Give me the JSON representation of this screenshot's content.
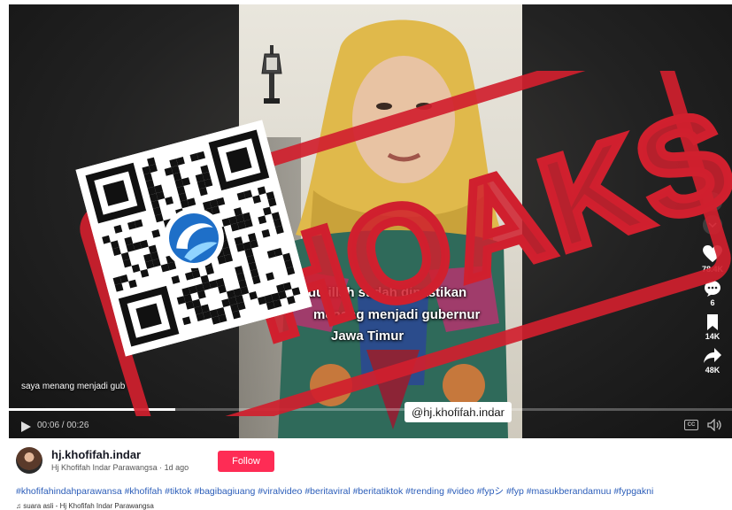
{
  "video": {
    "side_caption": "saya menang menjadi gub",
    "caption_lines": [
      "dulillah sudah dipastikan",
      "menang menjadi gubernur",
      "Jawa Timur"
    ],
    "handle": "@hj.khofifah.indar",
    "time": "00:06 / 00:26",
    "progress": 0.23,
    "cc_label": "CC"
  },
  "actions": {
    "likes": "78.4K",
    "comments": "6",
    "saves": "14K",
    "shares": "48K"
  },
  "stamp": {
    "text": "HOAKS",
    "color": "#d0202e"
  },
  "meta": {
    "username": "hj.khofifah.indar",
    "subline": "Hj Khofifah Indar Parawangsa · 1d ago",
    "follow_label": "Follow",
    "hashtags": "#khofifahindahparawansa #khofifah #tiktok #bagibagiuang #viralvideo #beritaviral #beritatiktok #trending #video #fypシ #fyp #masukberandamuu #fypgakni",
    "music": "♫ suara asli - Hj Khofifah Indar Parawangsa"
  },
  "colors": {
    "accent": "#fe2c55",
    "hashtag": "#2b5db9"
  }
}
